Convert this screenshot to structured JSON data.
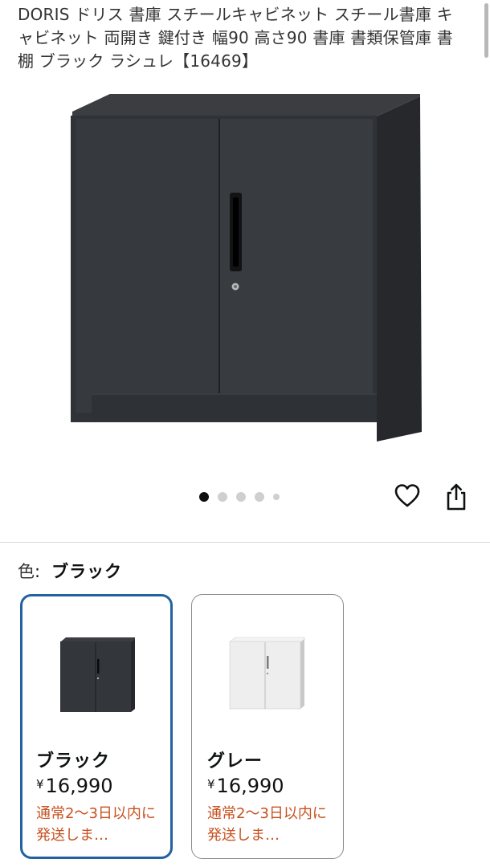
{
  "product": {
    "title": "DORIS ドリス 書庫 スチールキャビネット スチール書庫 キャビネット 両開き 鍵付き 幅90 高さ90 書庫 書類保管庫 書棚 ブラック ラシュレ【16469】"
  },
  "gallery": {
    "image_count": 5,
    "active_index": 0
  },
  "actions": {
    "favorite_icon": "heart-icon",
    "share_icon": "share-icon"
  },
  "variation": {
    "label": "色",
    "colon": ":",
    "selected_value": "ブラック",
    "options": [
      {
        "name": "ブラック",
        "currency": "¥",
        "price": "16,990",
        "shipping": "通常2～3日以内に発送しま…",
        "selected": true
      },
      {
        "name": "グレー",
        "currency": "¥",
        "price": "16,990",
        "shipping": "通常2～3日以内に発送しま…",
        "selected": false
      }
    ]
  },
  "colors": {
    "accent_selected_border": "#2162a1",
    "shipping_text": "#c7511f",
    "cabinet_black": "#33363a",
    "cabinet_gray": "#eeeeee"
  }
}
